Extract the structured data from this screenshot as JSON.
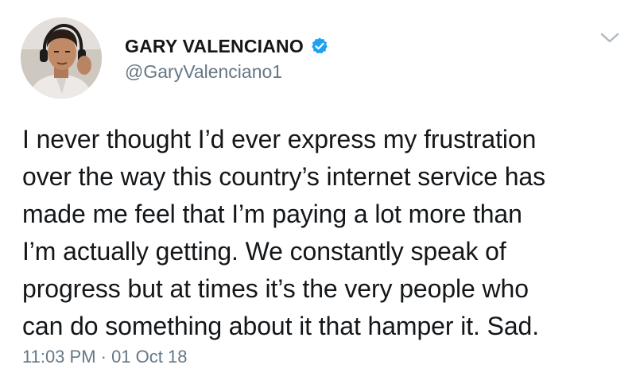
{
  "author": {
    "display_name": "GARY VALENCIANO",
    "handle": "@GaryValenciano1",
    "verified": true,
    "verified_icon": "verified-badge-icon",
    "avatar_icon": "profile-photo"
  },
  "menu": {
    "icon": "chevron-down-icon"
  },
  "tweet": {
    "lines": [
      "I never thought I’d ever express my frustration",
      "over the way this country’s internet service has",
      "made me feel that I’m paying a lot more than",
      "I’m actually getting. We constantly speak of",
      "progress but at times it’s the very people who",
      "can do something about it that hamper it. Sad."
    ],
    "timestamp": "11:03 PM · 01 Oct 18"
  },
  "colors": {
    "text": "#14171a",
    "secondary": "#657786",
    "verified": "#1da1f2",
    "chevron": "#aab8c2"
  }
}
